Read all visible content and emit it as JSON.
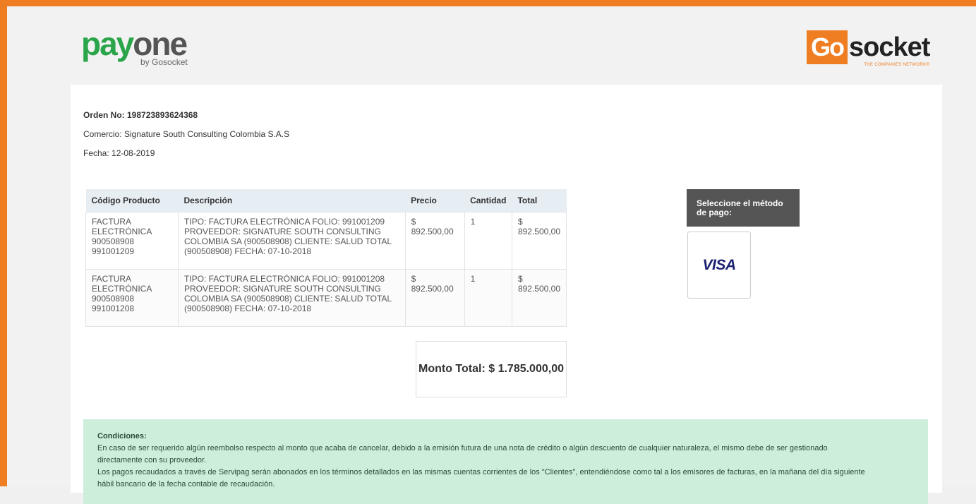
{
  "brand": {
    "payone_main": "pay",
    "payone_suffix": "one",
    "payone_by": "by Gosocket",
    "gosocket_go": "Go",
    "gosocket_rest": "socket",
    "gosocket_tagline": "THE COMPANIES NETWORK®"
  },
  "order": {
    "number": "Orden No: 198723893624368",
    "merchant": "Comercio: Signature South Consulting Colombia S.A.S",
    "date": "Fecha: 12-08-2019"
  },
  "table": {
    "headers": [
      "Código Producto",
      "Descripción",
      "Precio",
      "Cantidad",
      "Total"
    ],
    "rows": [
      {
        "code": [
          "FACTURA",
          "ELECTRÓNICA",
          "900508908",
          "991001209"
        ],
        "description": [
          "TIPO: FACTURA ELECTRÓNICA FOLIO: 991001209",
          "PROVEEDOR: SIGNATURE SOUTH CONSULTING",
          "COLOMBIA SA (900508908) CLIENTE: SALUD TOTAL",
          "(900508908) FECHA: 07-10-2018"
        ],
        "price": "$ 892.500,00",
        "quantity": "1",
        "total": "$ 892.500,00"
      },
      {
        "code": [
          "FACTURA",
          "ELECTRÓNICA",
          "900508908",
          "991001208"
        ],
        "description": [
          "TIPO: FACTURA ELECTRÓNICA FOLIO: 991001208",
          "PROVEEDOR: SIGNATURE SOUTH CONSULTING",
          "COLOMBIA SA (900508908) CLIENTE: SALUD TOTAL",
          "(900508908) FECHA: 07-10-2018"
        ],
        "price": "$ 892.500,00",
        "quantity": "1",
        "total": "$ 892.500,00"
      }
    ]
  },
  "total": {
    "label": "Monto Total: $ 1.785.000,00"
  },
  "payment": {
    "header": "Seleccione el método de pago:",
    "visa_label": "VISA"
  },
  "conditions": {
    "title": "Condiciones:",
    "line1": "En caso de ser requerido algún reembolso respecto al monto que acaba de cancelar, debido a la emisión futura de una nota de crédito o algún descuento de cualquier naturaleza, el mismo debe de ser gestionado",
    "line2": "directamente con su proveedor.",
    "line3": "Los pagos recaudados a través de Servipag serán abonados en los términos detallados en las mismas cuentas corrientes de los \"Clientes\", entendiéndose como tal a los emisores de facturas, en la mañana del día siguiente",
    "line4": "hábil bancario de la fecha contable de recaudación."
  },
  "colors": {
    "accent": "#ef7d22",
    "payone_green": "#2aa54a",
    "visa_blue": "#1a1f71",
    "conditions_bg": "#cdeeda"
  }
}
